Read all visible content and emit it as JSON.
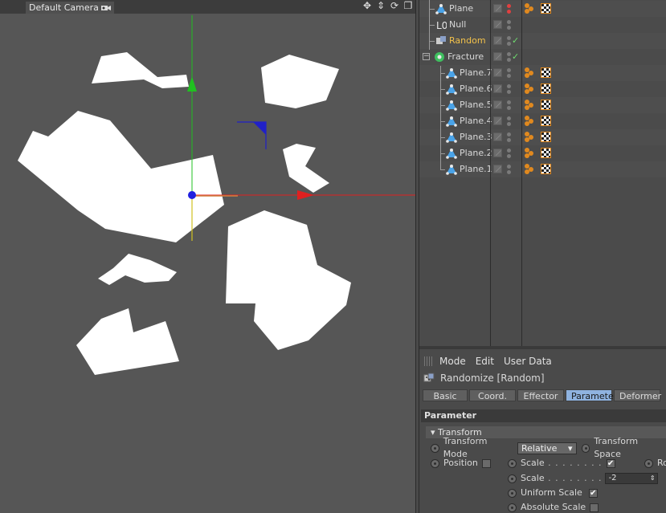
{
  "viewport": {
    "camera_label": "Default Camera",
    "nav_icons": [
      "move-view-icon",
      "dolly-icon",
      "rotate-view-icon",
      "maximize-icon"
    ]
  },
  "object_manager": {
    "objects": [
      {
        "name": "Plane",
        "icon": "plane-icon",
        "indent": 1,
        "tags": true,
        "dot": "red",
        "check": false,
        "highlight": false
      },
      {
        "name": "Null",
        "icon": "null-icon",
        "indent": 1,
        "tags": false,
        "dot": "grey",
        "check": false,
        "highlight": false
      },
      {
        "name": "Random",
        "icon": "random-effector-icon",
        "indent": 1,
        "tags": false,
        "dot": "grey",
        "check": true,
        "highlight": true
      },
      {
        "name": "Fracture",
        "icon": "fracture-icon",
        "indent": 0,
        "tags": false,
        "dot": "grey",
        "check": true,
        "highlight": false
      },
      {
        "name": "Plane.7",
        "icon": "plane-icon",
        "indent": 2,
        "tags": true,
        "dot": "grey",
        "check": false,
        "highlight": false
      },
      {
        "name": "Plane.6",
        "icon": "plane-icon",
        "indent": 2,
        "tags": true,
        "dot": "grey",
        "check": false,
        "highlight": false
      },
      {
        "name": "Plane.5",
        "icon": "plane-icon",
        "indent": 2,
        "tags": true,
        "dot": "grey",
        "check": false,
        "highlight": false
      },
      {
        "name": "Plane.4",
        "icon": "plane-icon",
        "indent": 2,
        "tags": true,
        "dot": "grey",
        "check": false,
        "highlight": false
      },
      {
        "name": "Plane.3",
        "icon": "plane-icon",
        "indent": 2,
        "tags": true,
        "dot": "grey",
        "check": false,
        "highlight": false
      },
      {
        "name": "Plane.2",
        "icon": "plane-icon",
        "indent": 2,
        "tags": true,
        "dot": "grey",
        "check": false,
        "highlight": false
      },
      {
        "name": "Plane.1",
        "icon": "plane-icon",
        "indent": 2,
        "tags": true,
        "dot": "grey",
        "check": false,
        "highlight": false
      }
    ]
  },
  "attribute_manager": {
    "menu": [
      "Mode",
      "Edit",
      "User Data"
    ],
    "title": "Randomize [Random]",
    "tabs": [
      "Basic",
      "Coord.",
      "Effector",
      "Parameter",
      "Deformer"
    ],
    "active_tab": "Parameter",
    "section": "Parameter",
    "group": "Transform",
    "transform_mode_label": "Transform Mode",
    "transform_mode_value": "Relative",
    "transform_space_label": "Transform Space",
    "position_label": "Position",
    "position_checked": false,
    "scale_label": "Scale",
    "scale_checked": true,
    "scale_value_label": "Scale",
    "scale_value": "-2",
    "uniform_scale_label": "Uniform Scale",
    "uniform_scale_checked": true,
    "absolute_scale_label": "Absolute Scale",
    "absolute_scale_checked": false,
    "rotation_label_partial": "Ro"
  },
  "colors": {
    "x_axis": "#e02020",
    "y_axis": "#20c020",
    "origin": "#2020e0",
    "highlight_text": "#f3c24a",
    "active_tab": "#8fb3e0"
  }
}
